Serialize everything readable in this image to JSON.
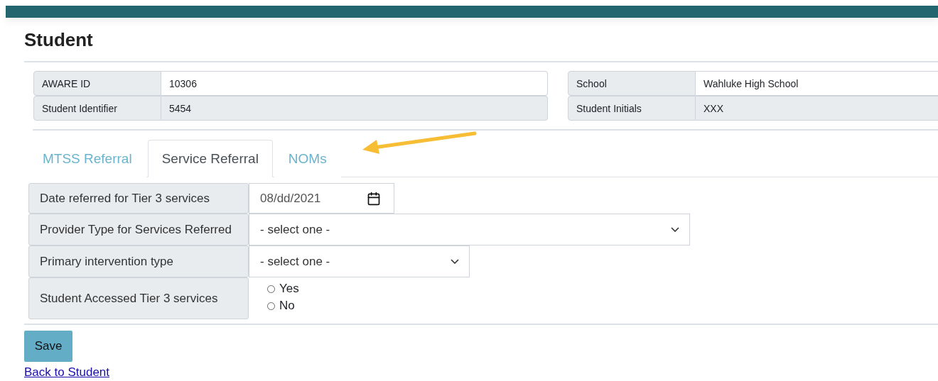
{
  "page": {
    "title": "Student"
  },
  "info_groups": [
    {
      "rows": [
        {
          "label": "AWARE ID",
          "value": "10306",
          "readonly": false
        },
        {
          "label": "Student Identifier",
          "value": "5454",
          "readonly": true
        }
      ]
    },
    {
      "rows": [
        {
          "label": "School",
          "value": "Wahluke High School",
          "readonly": false
        },
        {
          "label": "Student Initials",
          "value": "XXX",
          "readonly": true
        }
      ]
    }
  ],
  "tabs": [
    {
      "label": "MTSS Referral",
      "selected": false
    },
    {
      "label": "Service Referral",
      "selected": true
    },
    {
      "label": "NOMs",
      "selected": false
    }
  ],
  "form_rows": [
    {
      "kind": "date",
      "label": "Date referred for Tier 3 services",
      "value": "08/dd/2021"
    },
    {
      "kind": "select",
      "label": "Provider Type for Services Referred",
      "value": "- select one -",
      "wide": true
    },
    {
      "kind": "select",
      "label": "Primary intervention type",
      "value": "- select one -",
      "wide": false
    },
    {
      "kind": "radio",
      "label": "Student Accessed Tier 3 services",
      "options": [
        {
          "label": "Yes",
          "selected": false
        },
        {
          "label": "No",
          "selected": false
        }
      ]
    }
  ],
  "save_button": "Save",
  "back_link": "Back to Student"
}
